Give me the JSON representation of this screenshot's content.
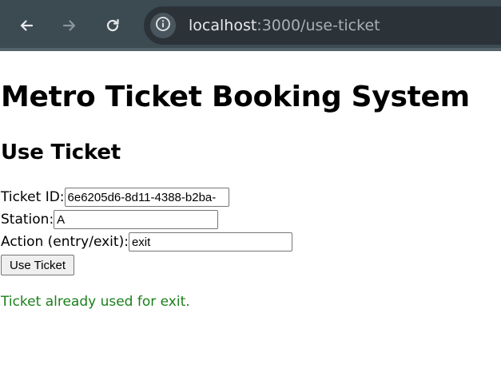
{
  "browser": {
    "url_host": "localhost",
    "url_path": ":3000/use-ticket",
    "icons": {
      "back": "arrow-left-icon",
      "forward": "arrow-right-icon",
      "reload": "reload-icon",
      "site_info": "info-icon"
    }
  },
  "page": {
    "title": "Metro Ticket Booking System",
    "section_title": "Use Ticket"
  },
  "form": {
    "ticket_id_label": "Ticket ID:",
    "ticket_id_value": "6e6205d6-8d11-4388-b2ba-",
    "station_label": "Station:",
    "station_value": "A",
    "action_label": "Action (entry/exit):",
    "action_value": "exit",
    "submit_label": "Use Ticket"
  },
  "status": {
    "message": "Ticket already used for exit.",
    "color": "#1a7f1a"
  },
  "colors": {
    "toolbar": "#3c4a52",
    "omnibox": "#2b3338"
  }
}
